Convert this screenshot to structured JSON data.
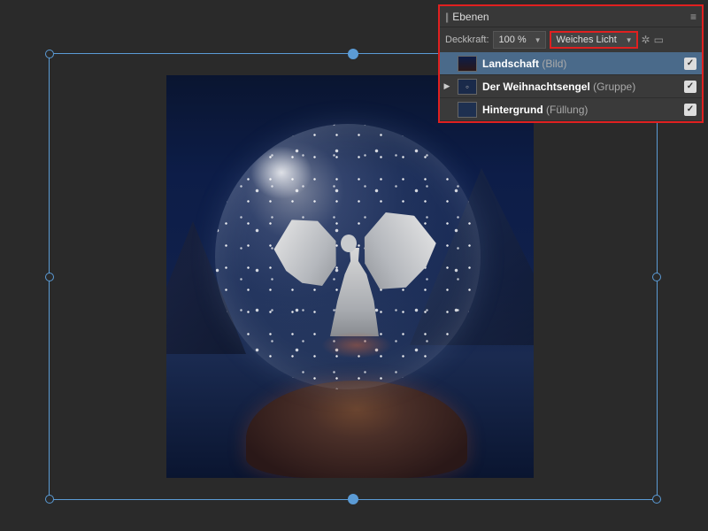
{
  "panel": {
    "title": "Ebenen",
    "opacity_label": "Deckkraft:",
    "opacity_value": "100 %",
    "blend_mode": "Weiches Licht"
  },
  "layers": [
    {
      "name": "Landschaft",
      "type": "Bild",
      "selected": true,
      "expandable": false
    },
    {
      "name": "Der Weihnachtsengel",
      "type": "Gruppe",
      "selected": false,
      "expandable": true
    },
    {
      "name": "Hintergrund",
      "type": "Füllung",
      "selected": false,
      "expandable": false
    }
  ],
  "icons": {
    "menu": "≡",
    "gear": "✿",
    "lock": "⬚",
    "dropdown": "▼",
    "expand": "▶",
    "check": "✓",
    "grip": "||"
  }
}
